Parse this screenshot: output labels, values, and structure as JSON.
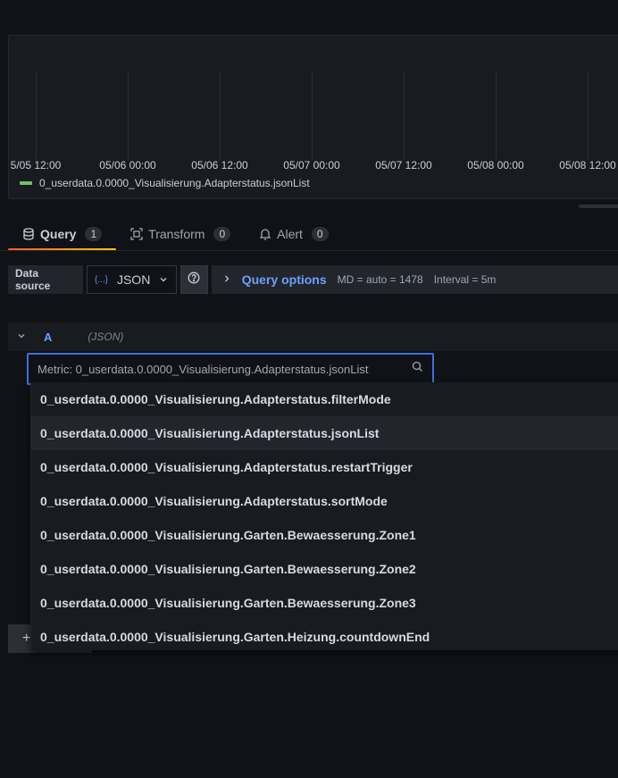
{
  "chart_data": {
    "type": "line",
    "x_ticks": [
      "5/05 12:00",
      "05/06 00:00",
      "05/06 12:00",
      "05/07 00:00",
      "05/07 12:00",
      "05/08 00:00",
      "05/08 12:00"
    ],
    "series": [
      {
        "name": "0_userdata.0.0000_Visualisierung.Adapterstatus.jsonList",
        "color": "#73bf69",
        "values": []
      }
    ],
    "grid": true,
    "legend": "bottom-left"
  },
  "tabs": [
    {
      "label": "Query",
      "count": "1",
      "icon": "database-icon",
      "active": true
    },
    {
      "label": "Transform",
      "count": "0",
      "icon": "transform-icon",
      "active": false
    },
    {
      "label": "Alert",
      "count": "0",
      "icon": "bell-icon",
      "active": false
    }
  ],
  "datasource": {
    "label": "Data source",
    "logo": "{...}",
    "selected": "JSON"
  },
  "query_options": {
    "title": "Query options",
    "md": "MD = auto = 1478",
    "interval": "Interval = 5m"
  },
  "query": {
    "ref_id": "A",
    "datasource": "(JSON)",
    "metric_placeholder": "Metric: 0_userdata.0.0000_Visualisierung.Adapterstatus.jsonList"
  },
  "dropdown": {
    "selected_index": 1,
    "items": [
      "0_userdata.0.0000_Visualisierung.Adapterstatus.filterMode",
      "0_userdata.0.0000_Visualisierung.Adapterstatus.jsonList",
      "0_userdata.0.0000_Visualisierung.Adapterstatus.restartTrigger",
      "0_userdata.0.0000_Visualisierung.Adapterstatus.sortMode",
      "0_userdata.0.0000_Visualisierung.Garten.Bewaesserung.Zone1",
      "0_userdata.0.0000_Visualisierung.Garten.Bewaesserung.Zone2",
      "0_userdata.0.0000_Visualisierung.Garten.Bewaesserung.Zone3",
      "0_userdata.0.0000_Visualisierung.Garten.Heizung.countdownEnd"
    ]
  },
  "add_query": {
    "label": "+"
  }
}
